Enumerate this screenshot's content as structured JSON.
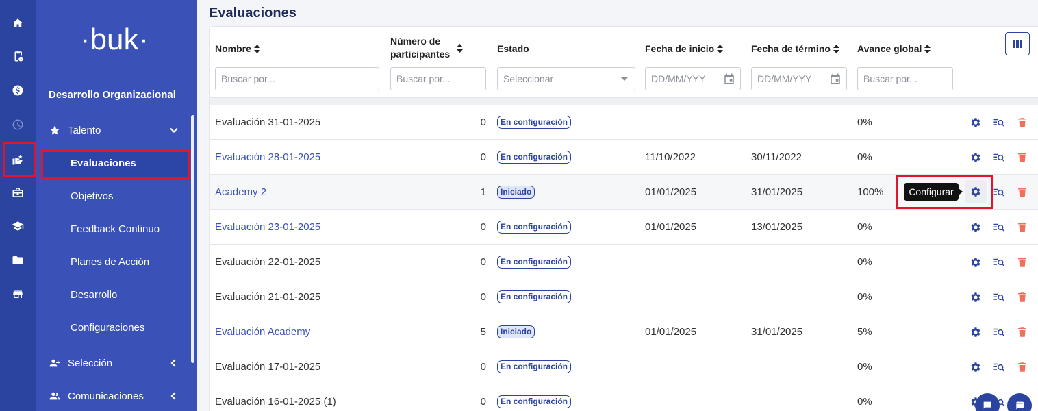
{
  "rail": {
    "items": [
      {
        "icon": "home-icon"
      },
      {
        "icon": "clipboard-clock-icon"
      },
      {
        "icon": "dollar-icon"
      },
      {
        "icon": "clock-icon"
      },
      {
        "icon": "talent-hand-icon"
      },
      {
        "icon": "briefcase-icon"
      },
      {
        "icon": "graduation-cap-icon"
      },
      {
        "icon": "folder-icon"
      },
      {
        "icon": "store-icon"
      }
    ]
  },
  "sidebar": {
    "logo": "·buk·",
    "section_title": "Desarrollo Organizacional",
    "groups": {
      "talento": {
        "label": "Talento",
        "icon": "star-icon"
      },
      "seleccion": {
        "label": "Selección",
        "icon": "person-add-icon"
      },
      "comunicaciones": {
        "label": "Comunicaciones",
        "icon": "people-icon"
      }
    },
    "sub_items": [
      "Evaluaciones",
      "Objetivos",
      "Feedback Continuo",
      "Planes de Acción",
      "Desarrollo",
      "Configuraciones"
    ]
  },
  "page": {
    "title": "Evaluaciones"
  },
  "table": {
    "headers": {
      "nombre": "Nombre",
      "participantes_1": "Número de",
      "participantes_2": "participantes",
      "estado": "Estado",
      "inicio": "Fecha de inicio",
      "termino": "Fecha de término",
      "avance": "Avance global"
    },
    "filters": {
      "nombre_placeholder": "Buscar por...",
      "participantes_placeholder": "Buscar por...",
      "estado_placeholder": "Seleccionar",
      "inicio_placeholder": "DD/MM/YYY",
      "termino_placeholder": "DD/MM/YYY",
      "avance_placeholder": "Buscar por..."
    },
    "rows": [
      {
        "nombre": "Evaluación 31-01-2025",
        "participantes": "0",
        "estado": "En configuración",
        "inicio": "",
        "termino": "",
        "avance": "0%"
      },
      {
        "nombre": "Evaluación 28-01-2025",
        "participantes": "0",
        "estado": "En configuración",
        "inicio": "11/10/2022",
        "termino": "30/11/2022",
        "avance": "0%"
      },
      {
        "nombre": "Academy 2",
        "participantes": "1",
        "estado": "Iniciado",
        "inicio": "01/01/2025",
        "termino": "31/01/2025",
        "avance": "100%"
      },
      {
        "nombre": "Evaluación 23-01-2025",
        "participantes": "0",
        "estado": "En configuración",
        "inicio": "01/01/2025",
        "termino": "13/01/2025",
        "avance": "0%"
      },
      {
        "nombre": "Evaluación 22-01-2025",
        "participantes": "0",
        "estado": "En configuración",
        "inicio": "",
        "termino": "",
        "avance": "0%"
      },
      {
        "nombre": "Evaluación 21-01-2025",
        "participantes": "0",
        "estado": "En configuración",
        "inicio": "",
        "termino": "",
        "avance": "0%"
      },
      {
        "nombre": "Evaluación Academy",
        "participantes": "5",
        "estado": "Iniciado",
        "inicio": "01/01/2025",
        "termino": "31/01/2025",
        "avance": "5%"
      },
      {
        "nombre": "Evaluación 17-01-2025",
        "participantes": "0",
        "estado": "En configuración",
        "inicio": "",
        "termino": "",
        "avance": "0%"
      },
      {
        "nombre": "Evaluación 16-01-2025 (1)",
        "participantes": "0",
        "estado": "En configuración",
        "inicio": "",
        "termino": "",
        "avance": "0%"
      }
    ],
    "row_actions": {
      "configure_icon": "gear-icon",
      "view_icon": "list-search-icon",
      "delete_icon": "trash-icon"
    }
  },
  "tooltip": {
    "text": "Configurar"
  },
  "colors": {
    "rail": "#2a44a0",
    "sidebar": "#3a52b8",
    "accent": "#2a44a0",
    "link": "#3a52b8",
    "delete": "#f0705a",
    "highlight": "#e3152a"
  }
}
